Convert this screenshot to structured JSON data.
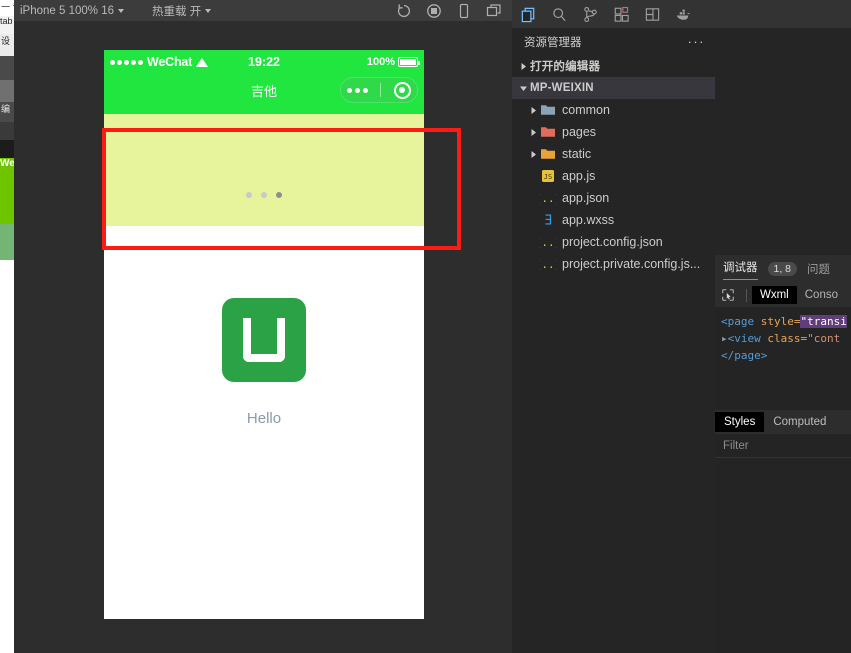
{
  "simulator_toolbar": {
    "device": "iPhone 5 100% 16",
    "hot_reload": "热重载 开",
    "icons": [
      "refresh-icon",
      "record-icon",
      "phone-icon",
      "window-icon"
    ]
  },
  "phone": {
    "status_bar": {
      "carrier": "WeChat",
      "signal_dots": 5,
      "time": "19:22",
      "battery_percent": "100%"
    },
    "nav": {
      "title": "吉他",
      "capsule": [
        "more-dots-icon",
        "target-icon"
      ]
    },
    "swiper": {
      "dot_count": 3,
      "active_index": 2
    },
    "content": {
      "logo": "uniapp-logo-icon",
      "hello": "Hello"
    }
  },
  "vscode": {
    "activity_bar": [
      "explorer-icon",
      "search-icon",
      "source-control-icon",
      "extensions-icon",
      "layout-icon",
      "docker-icon"
    ],
    "explorer": {
      "title": "资源管理器",
      "more": "···",
      "rows": [
        {
          "label": "打开的编辑器",
          "type": "section",
          "expanded": false,
          "indent": 0
        },
        {
          "label": "MP-WEIXIN",
          "type": "section",
          "expanded": true,
          "indent": 0,
          "selected": true
        },
        {
          "label": "common",
          "type": "folder",
          "expanded": false,
          "indent": 1,
          "icon": "folder-icon"
        },
        {
          "label": "pages",
          "type": "folder",
          "expanded": false,
          "indent": 1,
          "icon": "folder-pages-icon"
        },
        {
          "label": "static",
          "type": "folder",
          "expanded": false,
          "indent": 1,
          "icon": "folder-static-icon"
        },
        {
          "label": "app.js",
          "type": "file",
          "indent": 1,
          "icon": "js-file-icon"
        },
        {
          "label": "app.json",
          "type": "file",
          "indent": 1,
          "icon": "json-file-icon"
        },
        {
          "label": "app.wxss",
          "type": "file",
          "indent": 1,
          "icon": "css-file-icon"
        },
        {
          "label": "project.config.json",
          "type": "file",
          "indent": 1,
          "icon": "json-file-icon"
        },
        {
          "label": "project.private.config.js...",
          "type": "file",
          "indent": 1,
          "icon": "json-file-icon"
        }
      ]
    },
    "debugger": {
      "tabs": [
        {
          "label": "调试器",
          "active": true
        },
        {
          "label": "1, 8",
          "badge": true
        },
        {
          "label": "问题",
          "active": false
        }
      ],
      "subtabs": [
        {
          "label": "Wxml",
          "active": true
        },
        {
          "label": "Conso",
          "active": false
        }
      ],
      "picker_icon": "element-picker-icon",
      "code": {
        "line1_tag": "<page",
        "line1_attr": " style=",
        "line1_val": "\"transi",
        "line2_tag": "<view",
        "line2_attr": " class=",
        "line2_val": "\"cont",
        "line3": "</page>"
      },
      "styles_tabs": [
        {
          "label": "Styles",
          "active": true
        },
        {
          "label": "Computed",
          "active": false
        }
      ],
      "filter_placeholder": "Filter"
    }
  },
  "background_window": {
    "fragment_titlebar": "一 专",
    "fragment_tab": "tab",
    "fragment_toolbar": "设",
    "fragment_label": "编",
    "fragment_green": "We"
  },
  "colors": {
    "wechat_green": "#22e640",
    "swiper_yellow": "#e8f49c",
    "logo_green": "#2ba245",
    "inspect_red": "#fd1b16",
    "accent_blue": "#4a9ef1"
  }
}
